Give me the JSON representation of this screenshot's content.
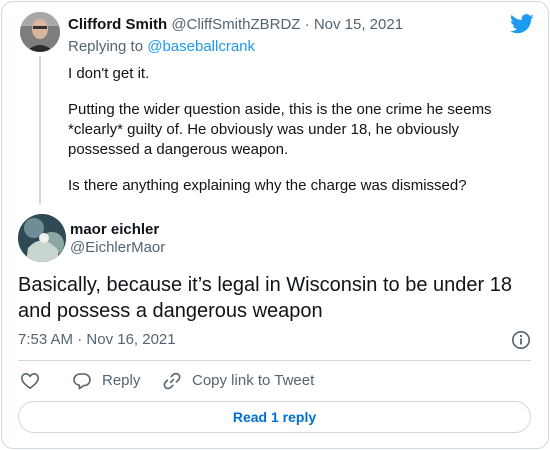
{
  "brand": {
    "logo_icon": "twitter-bird-icon",
    "color": "#1d9bf0"
  },
  "parent_tweet": {
    "author_name": "Clifford Smith",
    "author_handle": "@CliffSmithZBRDZ",
    "separator": "·",
    "date": "Nov 15, 2021",
    "replying_to_prefix": "Replying to",
    "replying_to_handle": "@baseballcrank",
    "paragraphs": [
      "I don't get it.",
      "Putting the wider question aside, this is the one crime he seems *clearly* guilty of. He obviously was under 18, he obviously possessed a dangerous weapon.",
      "Is there anything explaining why the charge was dismissed?"
    ]
  },
  "main_tweet": {
    "author_name": "maor eichler",
    "author_handle": "@EichlerMaor",
    "text": "Basically, because it’s legal in Wisconsin to be under 18 and possess a dangerous weapon",
    "time": "7:53 AM",
    "separator": "·",
    "date": "Nov 16, 2021"
  },
  "actions": {
    "like_icon": "heart-icon",
    "reply_label": "Reply",
    "reply_icon": "speech-bubble-icon",
    "copy_link_label": "Copy link to Tweet",
    "copy_link_icon": "link-icon"
  },
  "read_replies_label": "Read 1 reply",
  "colors": {
    "text": "#0f1419",
    "muted": "#536471",
    "border": "#cfd9de",
    "link": "#006fd6"
  }
}
